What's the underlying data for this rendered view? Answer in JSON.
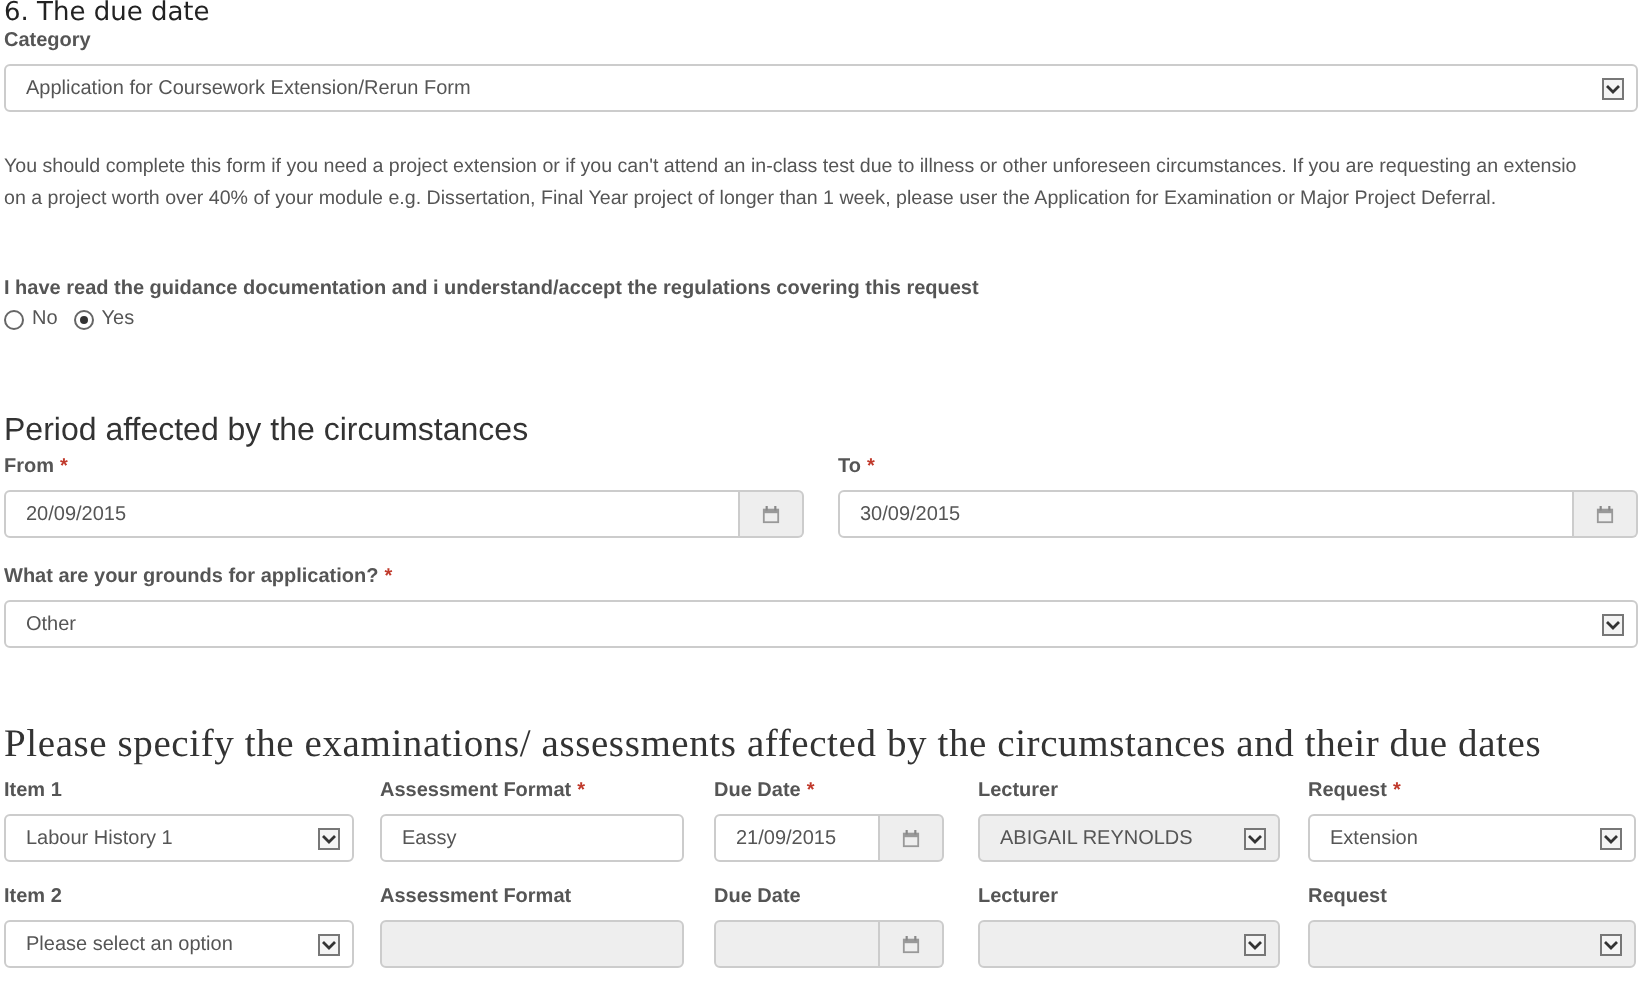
{
  "section_heading": "6. The due date",
  "category": {
    "label": "Category",
    "value": "Application for Coursework Extension/Rerun Form"
  },
  "guidance": "You should complete this form if you need a project extension or if you can't attend an in-class test due to illness or other unforeseen circumstances. If you are requesting an extensio\non a project worth over 40% of your module e.g. Dissertation, Final Year project of longer than 1 week, please user the Application for Examination or Major Project Deferral.",
  "confirmation": {
    "label": "I have read the guidance documentation and i understand/accept the regulations covering this request",
    "options": [
      {
        "label": "No",
        "selected": false
      },
      {
        "label": "Yes",
        "selected": true
      }
    ]
  },
  "period": {
    "title": "Period affected by the circumstances",
    "fields": [
      {
        "label": "From",
        "mark": "*",
        "value": "20/09/2015"
      },
      {
        "label": "To",
        "mark": "*",
        "value": "30/09/2015"
      }
    ]
  },
  "grounds": {
    "label": "What are your grounds for application?",
    "mark": "*",
    "value": "Other"
  },
  "assessments": {
    "title": "Please specify the examinations/ assessments affected by the circumstances and their due dates",
    "items": [
      {
        "fields": [
          {
            "kind": "select",
            "label": "Item 1",
            "value": "Labour History 1",
            "disabled": false
          },
          {
            "kind": "text",
            "label": "Assessment Format",
            "mark": "*",
            "value": "Eassy",
            "disabled": false
          },
          {
            "kind": "date",
            "label": "Due Date",
            "mark": "*",
            "value": "21/09/2015",
            "disabled": false
          },
          {
            "kind": "select",
            "label": "Lecturer",
            "value": "ABIGAIL REYNOLDS",
            "disabled": true
          },
          {
            "kind": "select",
            "label": "Request",
            "mark": "*",
            "value": "Extension",
            "disabled": false
          }
        ]
      },
      {
        "fields": [
          {
            "kind": "select",
            "label": "Item 2",
            "value": "Please select an option",
            "disabled": false
          },
          {
            "kind": "text",
            "label": "Assessment Format",
            "disabled": true
          },
          {
            "kind": "date",
            "label": "Due Date",
            "disabled": true
          },
          {
            "kind": "select",
            "label": "Lecturer",
            "disabled": true
          },
          {
            "kind": "select",
            "label": "Request",
            "disabled": true
          }
        ]
      }
    ]
  }
}
